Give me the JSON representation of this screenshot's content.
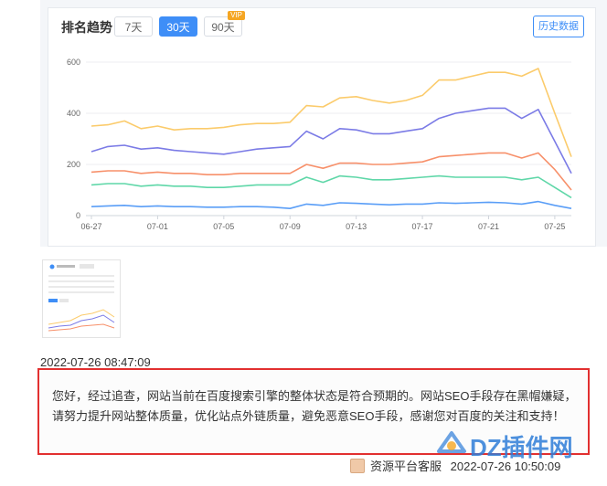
{
  "card": {
    "title": "排名趋势",
    "tabs": [
      {
        "label": "7天",
        "active": false
      },
      {
        "label": "30天",
        "active": true
      },
      {
        "label": "90天",
        "active": false,
        "badge": "VIP"
      }
    ],
    "history_button": "历史数据"
  },
  "chart_data": {
    "type": "line",
    "ylim": [
      0,
      600
    ],
    "yticks": [
      "0",
      "200",
      "400",
      "600"
    ],
    "xticks": [
      "06-27",
      "07-01",
      "07-05",
      "07-09",
      "07-13",
      "07-17",
      "07-21",
      "07-25"
    ],
    "x": [
      "06-27",
      "06-28",
      "06-29",
      "06-30",
      "07-01",
      "07-02",
      "07-03",
      "07-04",
      "07-05",
      "07-06",
      "07-07",
      "07-08",
      "07-09",
      "07-10",
      "07-11",
      "07-12",
      "07-13",
      "07-14",
      "07-15",
      "07-16",
      "07-17",
      "07-18",
      "07-19",
      "07-20",
      "07-21",
      "07-22",
      "07-23",
      "07-24",
      "07-25",
      "07-26"
    ],
    "grid": true,
    "series": [
      {
        "color": "#fbcb6b",
        "values": [
          350,
          355,
          370,
          340,
          350,
          335,
          340,
          340,
          345,
          355,
          360,
          360,
          365,
          430,
          425,
          460,
          465,
          450,
          440,
          450,
          470,
          530,
          530,
          545,
          560,
          560,
          545,
          575,
          400,
          230
        ]
      },
      {
        "color": "#7b7be6",
        "values": [
          250,
          270,
          275,
          260,
          265,
          255,
          250,
          245,
          240,
          250,
          260,
          265,
          270,
          330,
          300,
          340,
          335,
          320,
          320,
          330,
          340,
          380,
          400,
          410,
          420,
          420,
          380,
          415,
          290,
          165
        ]
      },
      {
        "color": "#f7906a",
        "values": [
          170,
          175,
          175,
          165,
          170,
          165,
          165,
          160,
          160,
          165,
          165,
          165,
          165,
          200,
          185,
          205,
          205,
          200,
          200,
          205,
          210,
          230,
          235,
          240,
          245,
          245,
          225,
          245,
          180,
          100
        ]
      },
      {
        "color": "#5fd7a8",
        "values": [
          120,
          125,
          125,
          115,
          120,
          115,
          115,
          110,
          110,
          115,
          120,
          120,
          120,
          150,
          130,
          155,
          150,
          140,
          140,
          145,
          150,
          155,
          150,
          150,
          150,
          150,
          140,
          150,
          110,
          70
        ]
      },
      {
        "color": "#5a9ef7",
        "values": [
          35,
          38,
          40,
          35,
          38,
          35,
          35,
          33,
          33,
          35,
          35,
          33,
          28,
          45,
          40,
          50,
          48,
          45,
          42,
          45,
          45,
          50,
          48,
          50,
          52,
          50,
          45,
          55,
          40,
          28
        ]
      }
    ]
  },
  "message": {
    "timestamp": "2022-07-26 08:47:09",
    "text": "您好，经过追查，网站当前在百度搜索引擎的整体状态是符合预期的。网站SEO手段存在黑帽嫌疑，请努力提升网站整体质量，优化站点外链质量，避免恶意SEO手段，感谢您对百度的关注和支持！",
    "sender": "资源平台客服",
    "reply_time": "2022-07-26 10:50:09"
  },
  "watermark": {
    "text": "DZ插件网"
  }
}
